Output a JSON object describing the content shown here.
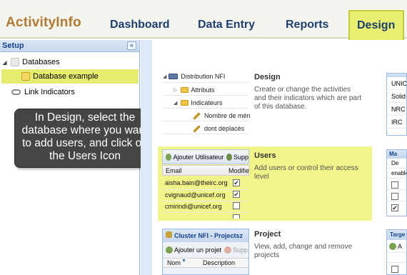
{
  "header": {
    "logo": "ActivityInfo",
    "tabs": [
      {
        "label": "Dashboard"
      },
      {
        "label": "Data Entry"
      },
      {
        "label": "Reports"
      },
      {
        "label": "Design"
      }
    ]
  },
  "left_panel": {
    "title": "Setup",
    "collapse_glyph": "«",
    "tree": {
      "databases_label": "Databases",
      "selected_db": "Database example",
      "link_indicators": "Link Indicators"
    }
  },
  "callout": "In Design, select the database where you want to add users, and click on the Users Icon",
  "sections": {
    "design": {
      "title": "Design",
      "description": "Create or change the activities and their indicators which are part of this database.",
      "preview": {
        "root": "Distribution NFI",
        "attributs": "Attributs",
        "indicateurs": "Indicateurs",
        "ind1": "Nombre de mén",
        "ind2": "dont déplacés"
      }
    },
    "users": {
      "title": "Users",
      "description": "Add users or control their access level",
      "preview": {
        "add_label": "Ajouter Utilisateur",
        "del_label": "Supp",
        "col_email": "Email",
        "col_modif": "Modifie",
        "rows": [
          {
            "email": "aisha.bain@theirc.org",
            "checked": "✔"
          },
          {
            "email": "cvignaud@unicef.org",
            "checked": "✔"
          },
          {
            "email": "cmirindi@unicef.org",
            "checked": ""
          }
        ]
      }
    },
    "project": {
      "title": "Project",
      "description": "View, add, change and remove projects",
      "preview": {
        "head": "Cluster NFI - Projectsz",
        "add_label": "Ajouter un projet",
        "del_label": "Supp",
        "col_name": "Nom",
        "col_desc": "Description"
      }
    }
  },
  "right_partials": {
    "design_rows": [
      "UNIC",
      "Solid",
      "NRC",
      "IRC"
    ],
    "users_head": "Ma",
    "users_row1": "De",
    "users_row2": "enable",
    "project_head": "Targe",
    "project_row": "A"
  },
  "colors": {
    "brand": "#b07a35",
    "nav": "#1d3f6e",
    "active_tab": "#e8ee70",
    "highlight": "#f0f489"
  }
}
